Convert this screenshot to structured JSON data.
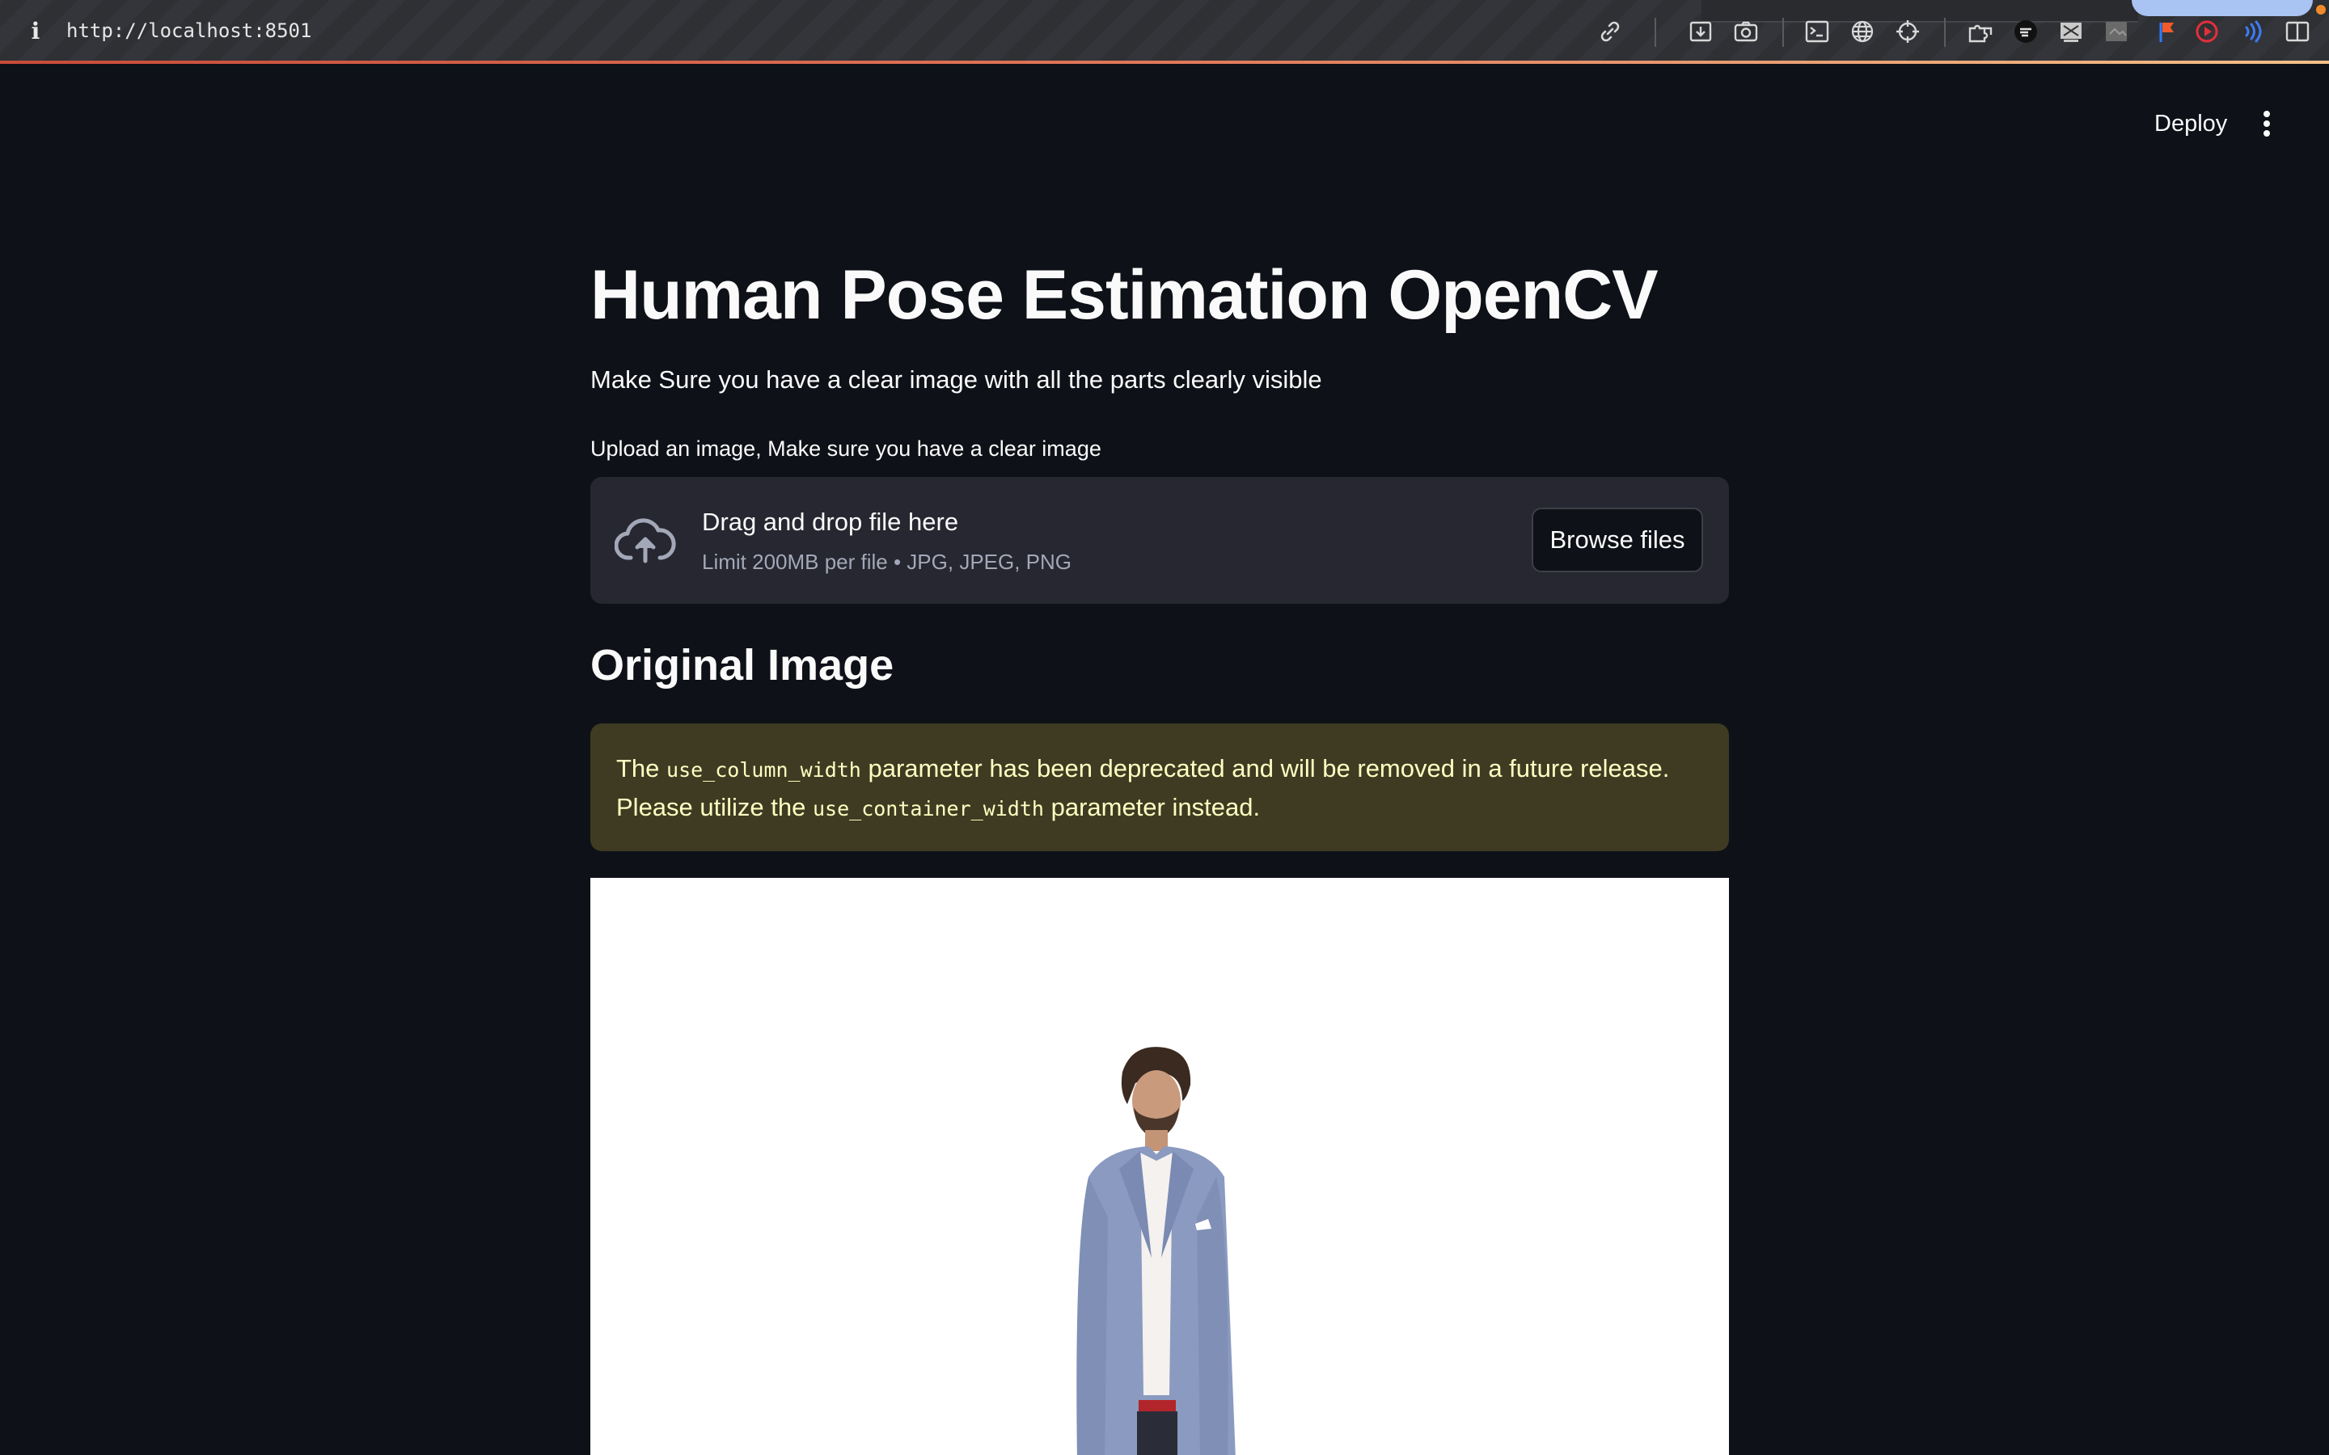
{
  "browser": {
    "url": "http://localhost:8501",
    "icons": [
      "info-icon",
      "link-icon",
      "download-icon",
      "camera-icon",
      "terminal-icon",
      "globe-icon",
      "crosshair-icon",
      "extension-icon",
      "tool-icon",
      "screen-icon",
      "image-icon",
      "flag-icon",
      "record-icon",
      "audio-icon",
      "sidebar-icon"
    ]
  },
  "header": {
    "deploy_label": "Deploy",
    "menu_icon": "kebab-menu-icon"
  },
  "main": {
    "title": "Human Pose Estimation OpenCV",
    "subtitle": "Make Sure you have a clear image with all the parts clearly visible",
    "uploader": {
      "label": "Upload an image, Make sure you have a clear image",
      "drop_title": "Drag and drop file here",
      "limit_text": "Limit 200MB per file • JPG, JPEG, PNG",
      "browse_label": "Browse files",
      "icon": "cloud-upload-icon"
    },
    "section_title": "Original Image",
    "warning": {
      "text_1": "The ",
      "code_1": "use_column_width",
      "text_2": " parameter has been deprecated and will be removed in a future release. Please utilize the ",
      "code_2": "use_container_width",
      "text_3": " parameter instead."
    }
  },
  "colors": {
    "background": "#0e1117",
    "dropzone": "#262730",
    "warning_bg": "#3e3b22",
    "warning_text": "#ffffc2"
  }
}
